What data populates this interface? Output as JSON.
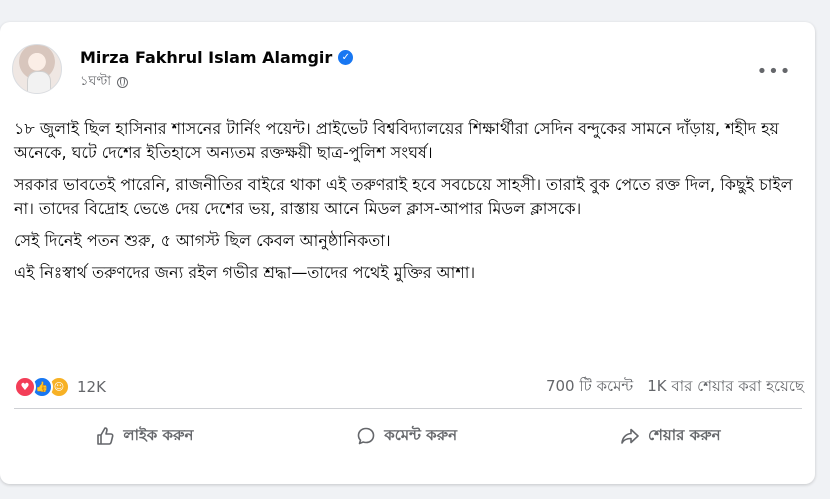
{
  "post": {
    "author": "Mirza Fakhrul Islam Alamgir",
    "verified_icon": "verified-badge-icon",
    "time": "১ঘণ্টা",
    "audience_icon": "globe-icon",
    "more_icon": "more-options-icon",
    "more_label": "•••",
    "paragraphs": [
      "১৮ জুলাই ছিল হাসিনার শাসনের টার্নিং পয়েন্ট। প্রাইভেট বিশ্ববিদ্যালয়ের শিক্ষার্থীরা সেদিন বন্দুকের সামনে দাঁড়ায়, শহীদ হয় অনেকে, ঘটে দেশের ইতিহাসে অন্যতম রক্তক্ষয়ী ছাত্র-পুলিশ সংঘর্ষ।",
      "সরকার ভাবতেই পারেনি, রাজনীতির বাইরে থাকা এই তরুণরাই হবে সবচেয়ে সাহসী। তারাই বুক পেতে রক্ত দিল, কিছুই চাইল না। তাদের বিদ্রোহ ভেঙে দেয় দেশের ভয়, রাস্তায় আনে মিডল ক্লাস-আপার মিডল ক্লাসকে।",
      "সেই দিনেই পতন শুরু, ৫ আগস্ট ছিল কেবল আনুষ্ঠানিকতা।",
      "এই নিঃস্বার্থ তরুণদের জন্য রইল গভীর শ্রদ্ধা—তাদের পথেই মুক্তির আশা।"
    ]
  },
  "stats": {
    "reaction_count": "12K",
    "comments": "700 টি কমেন্ট",
    "shares": "1K বার শেয়ার করা হয়েছে"
  },
  "actions": {
    "like": "লাইক করুন",
    "comment": "কমেন্ট করুন",
    "share": "শেয়ার করুন"
  },
  "colors": {
    "accent": "#1877f2",
    "love": "#f33e58",
    "haha": "#f7b125",
    "secondary_text": "#65676b"
  }
}
